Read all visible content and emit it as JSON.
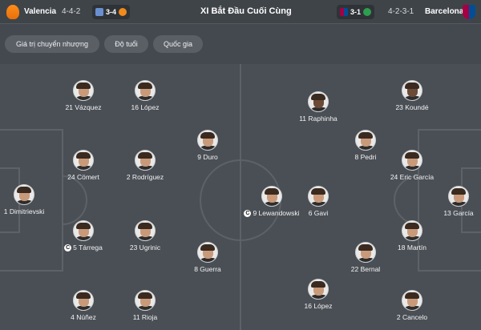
{
  "header": {
    "home_team": "Valencia",
    "home_formation": "4-4-2",
    "home_pill_score": "3-4",
    "title": "XI Bắt Đầu Cuối Cùng",
    "away_pill_score": "3-1",
    "away_formation": "4-2-3-1",
    "away_team": "Barcelona"
  },
  "filters": [
    "Giá trị chuyển nhượng",
    "Độ tuổi",
    "Quốc gia"
  ],
  "captain_mark": "C",
  "home_players": [
    {
      "label": "1 Dimitrievski"
    },
    {
      "label": "21 Vázquez"
    },
    {
      "label": "24 Cömert"
    },
    {
      "label": "5 Tárrega",
      "captain": true
    },
    {
      "label": "4 Núñez"
    },
    {
      "label": "16 López"
    },
    {
      "label": "2 Rodríguez"
    },
    {
      "label": "23 Ugrinic"
    },
    {
      "label": "11 Rioja"
    },
    {
      "label": "9 Duro"
    },
    {
      "label": "8 Guerra"
    }
  ],
  "away_players": [
    {
      "label": "13 García"
    },
    {
      "label": "23 Koundé"
    },
    {
      "label": "24 Eric García"
    },
    {
      "label": "18 Martín"
    },
    {
      "label": "2 Cancelo"
    },
    {
      "label": "8 Pedri"
    },
    {
      "label": "22 Bernal"
    },
    {
      "label": "11 Raphinha"
    },
    {
      "label": "6 Gavi"
    },
    {
      "label": "16 López"
    },
    {
      "label": "9 Lewandowski",
      "captain": true
    }
  ],
  "colors": {
    "pitch": "#4a4f55",
    "lines": "#5d6268",
    "header": "#3f4449"
  }
}
